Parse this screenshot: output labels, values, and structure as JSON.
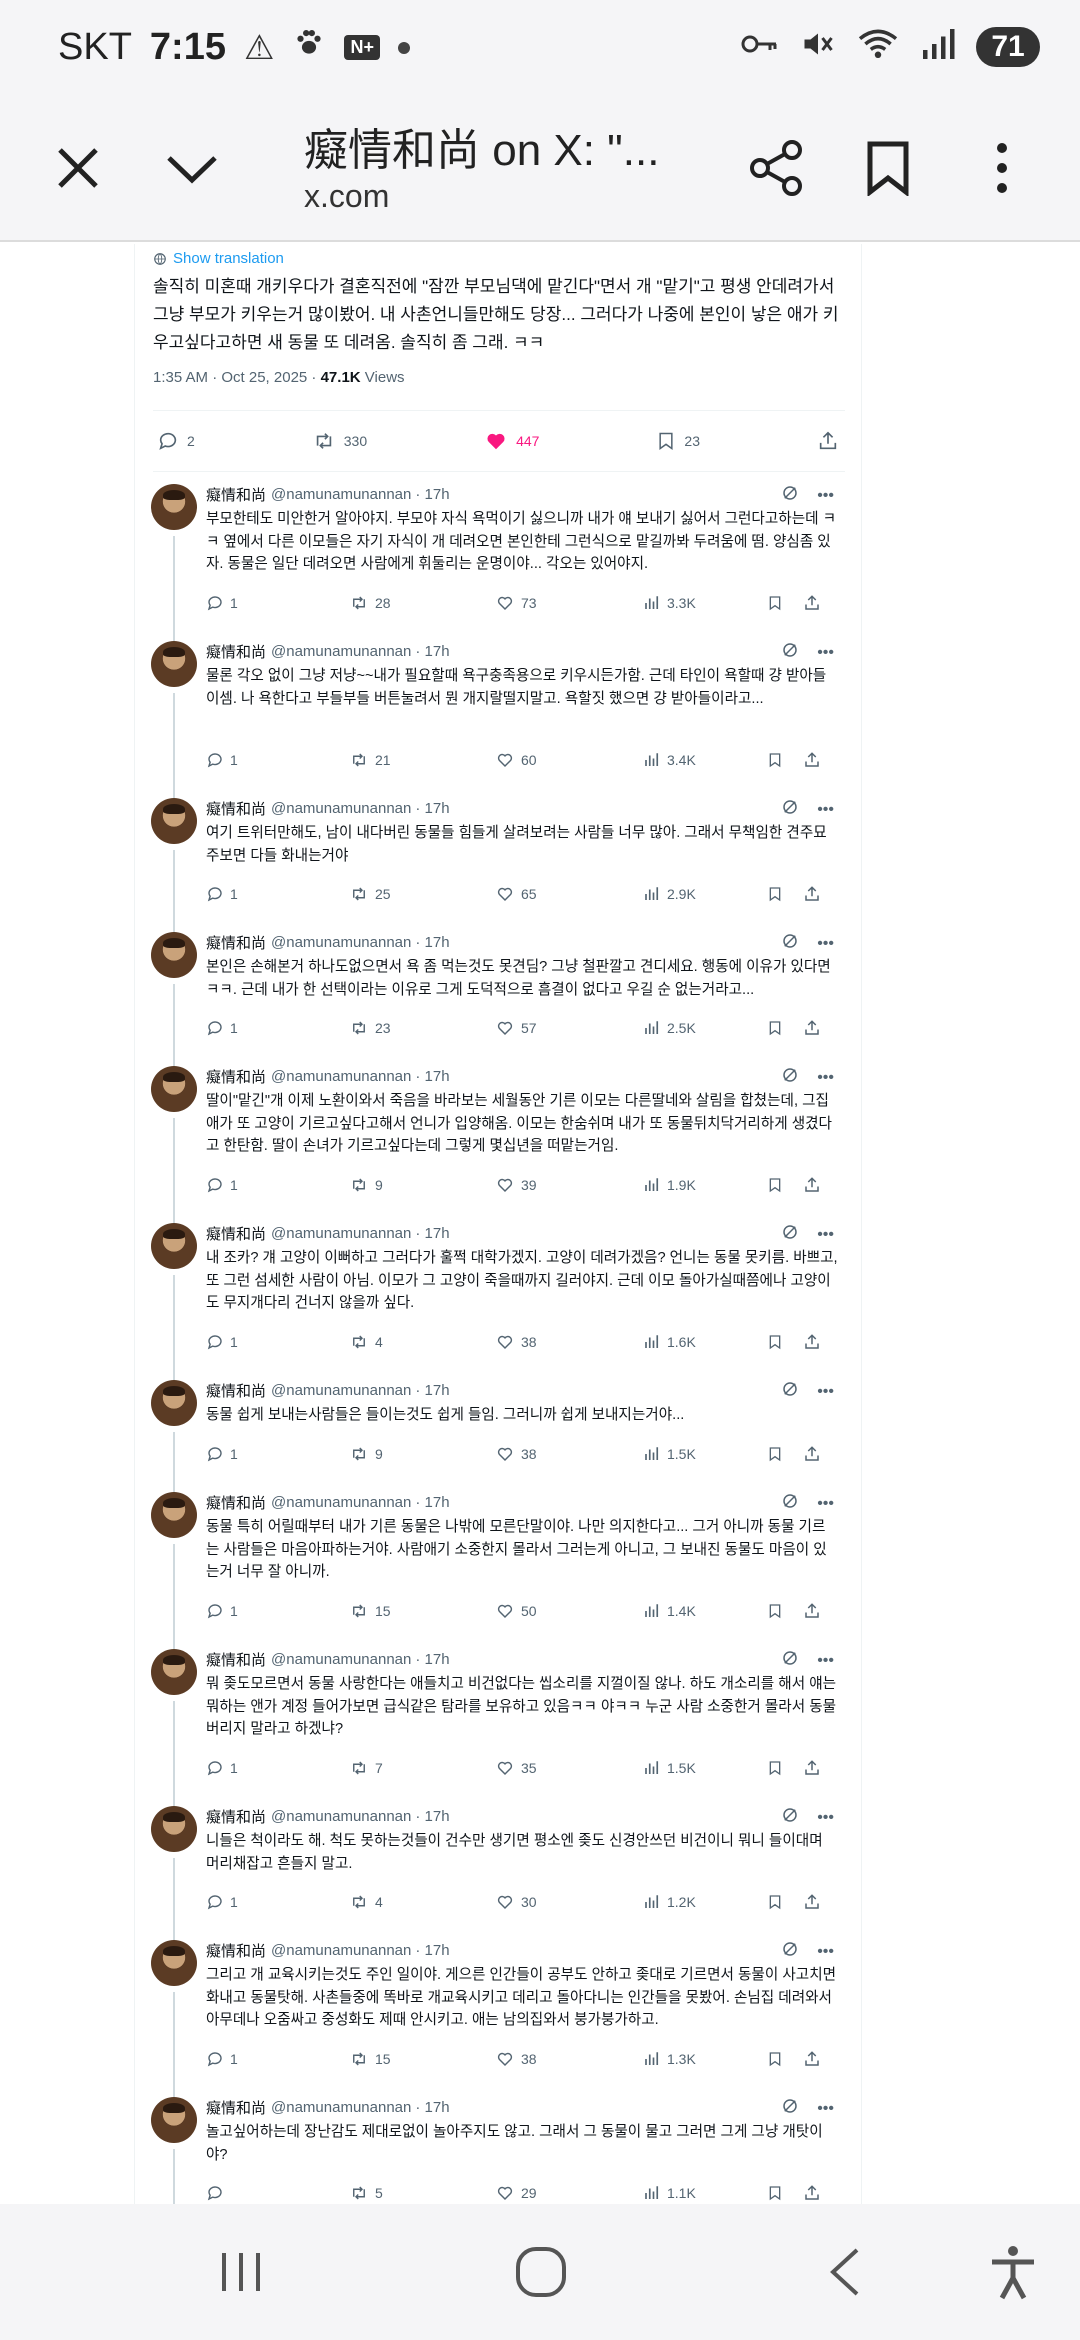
{
  "status_bar": {
    "carrier": "SKT",
    "time": "7:15",
    "battery": "71"
  },
  "app_bar": {
    "title": "癡情和尚 on X: \"...",
    "url": "x.com"
  },
  "main_tweet": {
    "show_translation": "Show translation",
    "text": "솔직히 미혼때 개키우다가 결혼직전에 \"잠깐 부모님댁에 맡긴다\"면서 개 \"맡기\"고 평생 안데려가서 그냥 부모가 키우는거 많이봤어. 내 사촌언니들만해도 당장... 그러다가 나중에 본인이 낳은 애가 키우고싶다고하면 새 동물 또 데려옴. 솔직히 좀 그래. ㅋㅋ",
    "time": "1:35 AM · Oct 25, 2025 · ",
    "views_count": "47.1K",
    "views_label": " Views",
    "replies": "2",
    "reposts": "330",
    "likes": "447",
    "bookmarks": "23"
  },
  "replies": [
    {
      "name": "癡情和尚",
      "handle": "@namunamunannan",
      "time": "· 17h",
      "text": "부모한테도 미안한거 알아야지. 부모야 자식 욕먹이기 싫으니까 내가 얘 보내기 싫어서 그런다고하는데 ㅋㅋ 옆에서 다른 이모들은 자기 자식이 개 데려오면 본인한테 그런식으로 맡길까봐 두려움에 떰. 양심좀 있자. 동물은 일단 데려오면 사람에게 휘둘리는 운명이야... 각오는 있어야지.",
      "replies": "1",
      "reposts": "28",
      "likes": "73",
      "views": "3.3K"
    },
    {
      "name": "癡情和尚",
      "handle": "@namunamunannan",
      "time": "· 17h",
      "text": "물론 각오 없이 그냥 저냥~~내가 필요할때 욕구충족용으로 키우시든가함. 근데 타인이 욕할때 걍 받아들이셈. 나 욕한다고 부들부들 버튼눌려서 뭔 개지랄떨지말고. 욕할짓 했으면 걍 받아들이라고...",
      "replies": "1",
      "reposts": "21",
      "likes": "60",
      "views": "3.4K"
    },
    {
      "name": "癡情和尚",
      "handle": "@namunamunannan",
      "time": "· 17h",
      "text": "여기 트위터만해도, 남이 내다버린 동물들 힘들게 살려보려는 사람들 너무 많아. 그래서 무책임한 견주묘주보면 다들 화내는거야",
      "replies": "1",
      "reposts": "25",
      "likes": "65",
      "views": "2.9K"
    },
    {
      "name": "癡情和尚",
      "handle": "@namunamunannan",
      "time": "· 17h",
      "text": "본인은 손해본거 하나도없으면서 욕 좀 먹는것도 못견딤? 그냥 철판깔고 견디세요. 행동에 이유가 있다면ㅋㅋ. 근데 내가 한 선택이라는 이유로 그게 도덕적으로 흠결이 없다고 우길 순 없는거라고...",
      "replies": "1",
      "reposts": "23",
      "likes": "57",
      "views": "2.5K"
    },
    {
      "name": "癡情和尚",
      "handle": "@namunamunannan",
      "time": "· 17h",
      "text": "딸이\"맡긴\"개 이제 노환이와서 죽음을 바라보는 세월동안 기른 이모는 다른딸네와 살림을 합쳤는데, 그집 애가 또 고양이 기르고싶다고해서 언니가 입양해옴. 이모는 한숨쉬며 내가 또 동물뒤치닥거리하게 생겼다고 한탄함. 딸이 손녀가 기르고싶다는데 그렇게 몇십년을 떠맡는거임.",
      "replies": "1",
      "reposts": "9",
      "likes": "39",
      "views": "1.9K"
    },
    {
      "name": "癡情和尚",
      "handle": "@namunamunannan",
      "time": "· 17h",
      "text": "내 조카? 걔 고양이 이뻐하고 그러다가 훌쩍 대학가겠지. 고양이 데려가겠음? 언니는 동물 못키름. 바쁘고, 또 그런 섬세한 사람이 아님. 이모가 그 고양이 죽을때까지 길러야지. 근데 이모 돌아가실때쯤에나 고양이도 무지개다리 건너지 않을까 싶다.",
      "replies": "1",
      "reposts": "4",
      "likes": "38",
      "views": "1.6K"
    },
    {
      "name": "癡情和尚",
      "handle": "@namunamunannan",
      "time": "· 17h",
      "text": "동물 쉽게 보내는사람들은 들이는것도 쉽게 들임. 그러니까 쉽게 보내지는거야...",
      "replies": "1",
      "reposts": "9",
      "likes": "38",
      "views": "1.5K"
    },
    {
      "name": "癡情和尚",
      "handle": "@namunamunannan",
      "time": "· 17h",
      "text": "동물 특히 어릴때부터 내가 기른 동물은 나밖에 모른단말이야. 나만 의지한다고... 그거 아니까 동물 기르는 사람들은 마음아파하는거야. 사람애기 소중한지 몰라서 그러는게 아니고, 그 보내진 동물도 마음이 있는거 너무 잘 아니까.",
      "replies": "1",
      "reposts": "15",
      "likes": "50",
      "views": "1.4K"
    },
    {
      "name": "癡情和尚",
      "handle": "@namunamunannan",
      "time": "· 17h",
      "text": "뭐 좆도모르면서 동물 사랑한다는 애들치고 비건없다는 씹소리를 지껄이질 않나. 하도 개소리를 해서 얘는 뭐하는 앤가 계정 들어가보면 급식같은 탐라를 보유하고 있음ㅋㅋ 야ㅋㅋ 누군 사람 소중한거 몰라서 동물 버리지 말라고 하겠냐?",
      "replies": "1",
      "reposts": "7",
      "likes": "35",
      "views": "1.5K"
    },
    {
      "name": "癡情和尚",
      "handle": "@namunamunannan",
      "time": "· 17h",
      "text": "니들은 척이라도 해. 척도 못하는것들이 건수만 생기면 평소엔 좆도 신경안쓰던 비건이니 뭐니 들이대며 머리채잡고 흔들지 말고.",
      "replies": "1",
      "reposts": "4",
      "likes": "30",
      "views": "1.2K"
    },
    {
      "name": "癡情和尚",
      "handle": "@namunamunannan",
      "time": "· 17h",
      "text": "그리고 개 교육시키는것도 주인 일이야. 게으른 인간들이 공부도 안하고 좆대로 기르면서 동물이 사고치면 화내고 동물탓해. 사촌들중에 똑바로 개교육시키고 데리고 돌아다니는 인간들을 못봤어. 손님집 데려와서 아무데나 오줌싸고 중성화도 제때 안시키고. 애는 남의집와서 붕가붕가하고.",
      "replies": "1",
      "reposts": "15",
      "likes": "38",
      "views": "1.3K"
    },
    {
      "name": "癡情和尚",
      "handle": "@namunamunannan",
      "time": "· 17h",
      "text": "놀고싶어하는데 장난감도 제대로없이 놀아주지도 않고. 그래서 그 동물이 물고 그러면 그게 그냥 개탓이야?",
      "replies": "",
      "reposts": "5",
      "likes": "29",
      "views": "1.1K"
    }
  ]
}
